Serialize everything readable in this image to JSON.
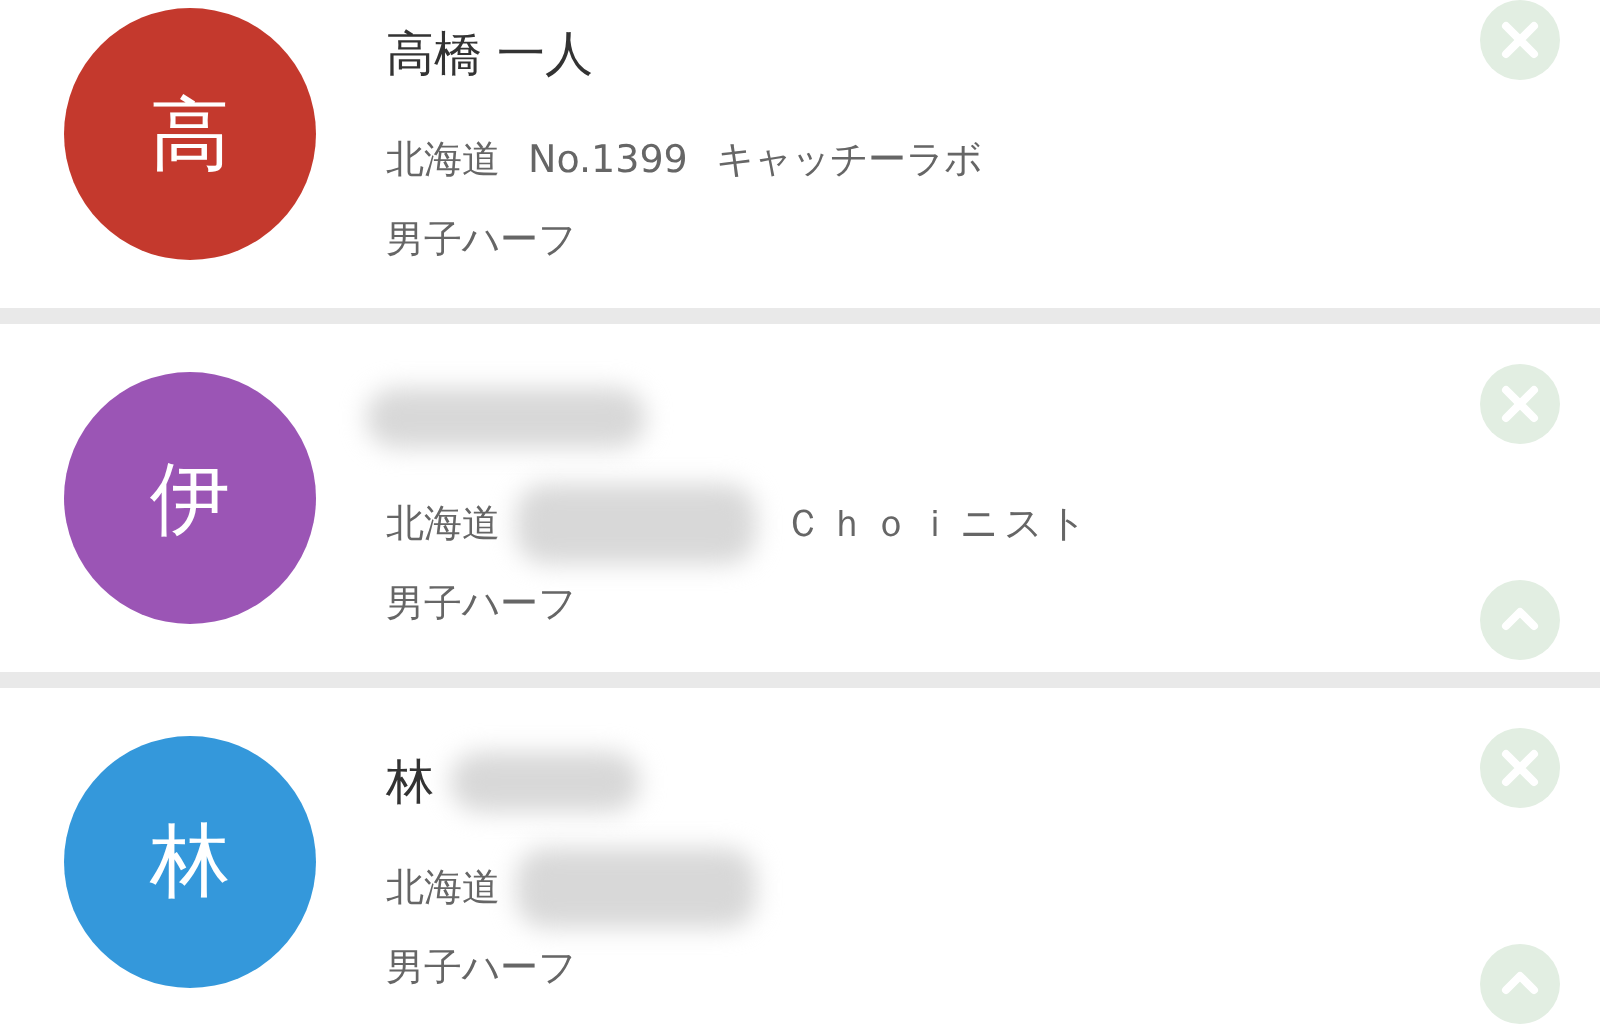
{
  "entries": [
    {
      "avatar": "高",
      "color": "#c4392d",
      "name": "高橋 一人",
      "name_blurred": false,
      "prefecture": "北海道",
      "number": "No.1399",
      "number_blurred": false,
      "team": "キャッチーラボ",
      "category": "男子ハーフ",
      "collapsible": false
    },
    {
      "avatar": "伊",
      "color": "#9b55b5",
      "name_blurred": true,
      "prefecture": "北海道",
      "number_blurred": true,
      "team": "Ｃｈｏｉニスト",
      "category": "男子ハーフ",
      "collapsible": true
    },
    {
      "avatar": "林",
      "color": "#3498db",
      "name": "林",
      "name_blurred": true,
      "prefecture": "北海道",
      "number_blurred": true,
      "category": "男子ハーフ",
      "collapsible": true
    }
  ]
}
